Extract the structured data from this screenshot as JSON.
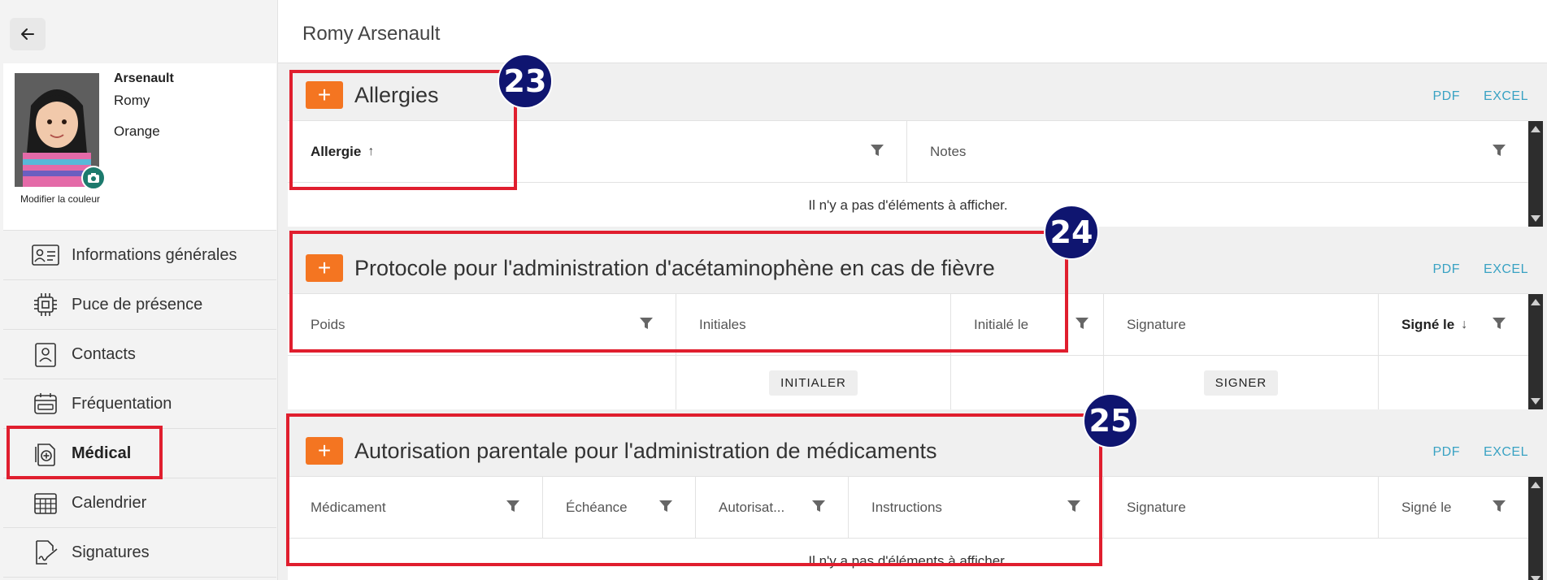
{
  "header": {
    "title": "Romy Arsenault"
  },
  "profile": {
    "last_name": "Arsenault",
    "first_name": "Romy",
    "group": "Orange",
    "edit_color_label": "Modifier la couleur"
  },
  "nav": [
    {
      "label": "Informations générales",
      "icon": "id-card-icon"
    },
    {
      "label": "Puce de présence",
      "icon": "chip-icon"
    },
    {
      "label": "Contacts",
      "icon": "contact-card-icon"
    },
    {
      "label": "Fréquentation",
      "icon": "attendance-icon"
    },
    {
      "label": "Médical",
      "icon": "medical-icon",
      "active": true
    },
    {
      "label": "Calendrier",
      "icon": "calendar-icon"
    },
    {
      "label": "Signatures",
      "icon": "signature-icon"
    }
  ],
  "links": {
    "pdf": "PDF",
    "excel": "EXCEL"
  },
  "sections": {
    "allergies": {
      "title": "Allergies",
      "columns": [
        "Allergie",
        "Notes"
      ],
      "empty": "Il n'y a pas d'éléments à afficher."
    },
    "protocol": {
      "title": "Protocole pour l'administration d'acétaminophène en cas de fièvre",
      "columns": [
        "Poids",
        "Initiales",
        "Initialé le",
        "Signature",
        "Signé le"
      ],
      "initial_button": "INITIALER",
      "sign_button": "SIGNER"
    },
    "authorization": {
      "title": "Autorisation parentale pour l'administration de médicaments",
      "columns": [
        "Médicament",
        "Échéance",
        "Autorisat...",
        "Instructions",
        "Signature",
        "Signé le"
      ],
      "empty": "Il n'y a pas d'éléments à afficher."
    }
  },
  "annotations": [
    "23",
    "24",
    "25"
  ],
  "colors": {
    "accent": "#f47521",
    "link": "#39a2c3",
    "highlight": "#e01e2e",
    "badge": "#0f1570"
  }
}
